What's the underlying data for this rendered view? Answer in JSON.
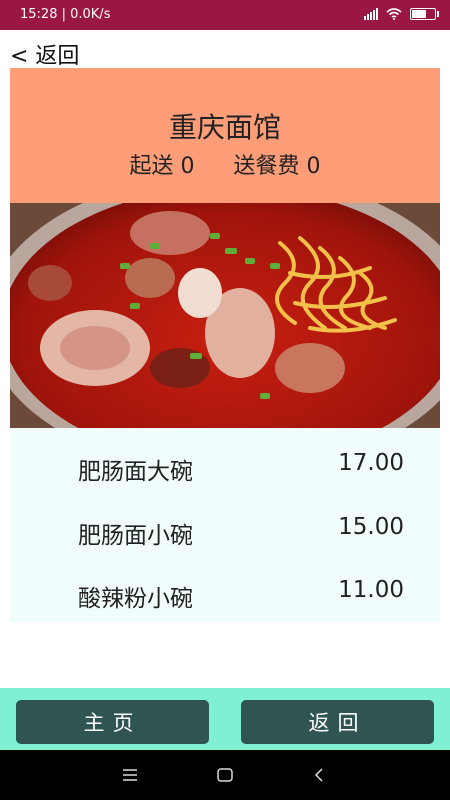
{
  "status_bar": {
    "time": "15:28 | 0.0K/s"
  },
  "nav": {
    "back_label": "< 返回"
  },
  "shop": {
    "name": "重庆面馆",
    "min_delivery_label": "起送 0",
    "delivery_fee_label": "送餐费 0"
  },
  "menu": {
    "items": [
      {
        "name": "肥肠面大碗",
        "price": "17.00"
      },
      {
        "name": "肥肠面小碗",
        "price": "15.00"
      },
      {
        "name": "酸辣粉小碗",
        "price": "11.00"
      }
    ]
  },
  "bottom": {
    "home_label": "主页",
    "back_label": "返回"
  },
  "colors": {
    "status_bar": "#9a1744",
    "header": "#ff9d79",
    "menu_bg": "#f1fdfc",
    "bottom_bar": "#7ff0d1",
    "button": "#2f5451"
  },
  "icons": [
    "signal-icon",
    "wifi-icon",
    "battery-icon",
    "menu-nav-icon",
    "home-nav-icon",
    "back-nav-icon"
  ]
}
